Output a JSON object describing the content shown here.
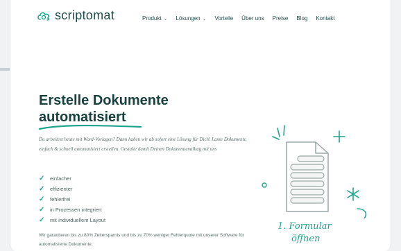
{
  "brand": {
    "name": "scriptomat",
    "color": "#1e4c4a",
    "accent": "#1fa58d",
    "logo_icon": "cloud-logo-icon"
  },
  "nav": [
    {
      "label": "Produkt",
      "dropdown": true
    },
    {
      "label": "Lösungen",
      "dropdown": true
    },
    {
      "label": "Vorteile",
      "dropdown": false
    },
    {
      "label": "Über uns",
      "dropdown": false
    },
    {
      "label": "Preise",
      "dropdown": false
    },
    {
      "label": "Blog",
      "dropdown": false
    },
    {
      "label": "Kontakt",
      "dropdown": false
    }
  ],
  "hero": {
    "title_line1": "Erstelle Dokumente",
    "title_line2": "automatisiert",
    "intro": "Du arbeitest heute mit Word-Vorlagen? Dann haben wir ab sofort eine Lösung für Dich! Lasse Dokumente einfach & schnell automatisiert erstellen. Gestalte damit Deinen Dokumentenalltag mit uns",
    "benefits": [
      "einfacher",
      "effizienter",
      "fehlerfrei",
      "in Prozessen integriert",
      "mit individuellem Layout"
    ],
    "bottom_text": "Wir garantieren bis zu 80% Zeitersparnis und bis zu 70% weniger Fehlerquote mit unserer Software für automatisierte Dokumente."
  },
  "illustration": {
    "icon": "document-form-icon",
    "caption_line1": "1. Formular",
    "caption_line2": "öffnen"
  }
}
